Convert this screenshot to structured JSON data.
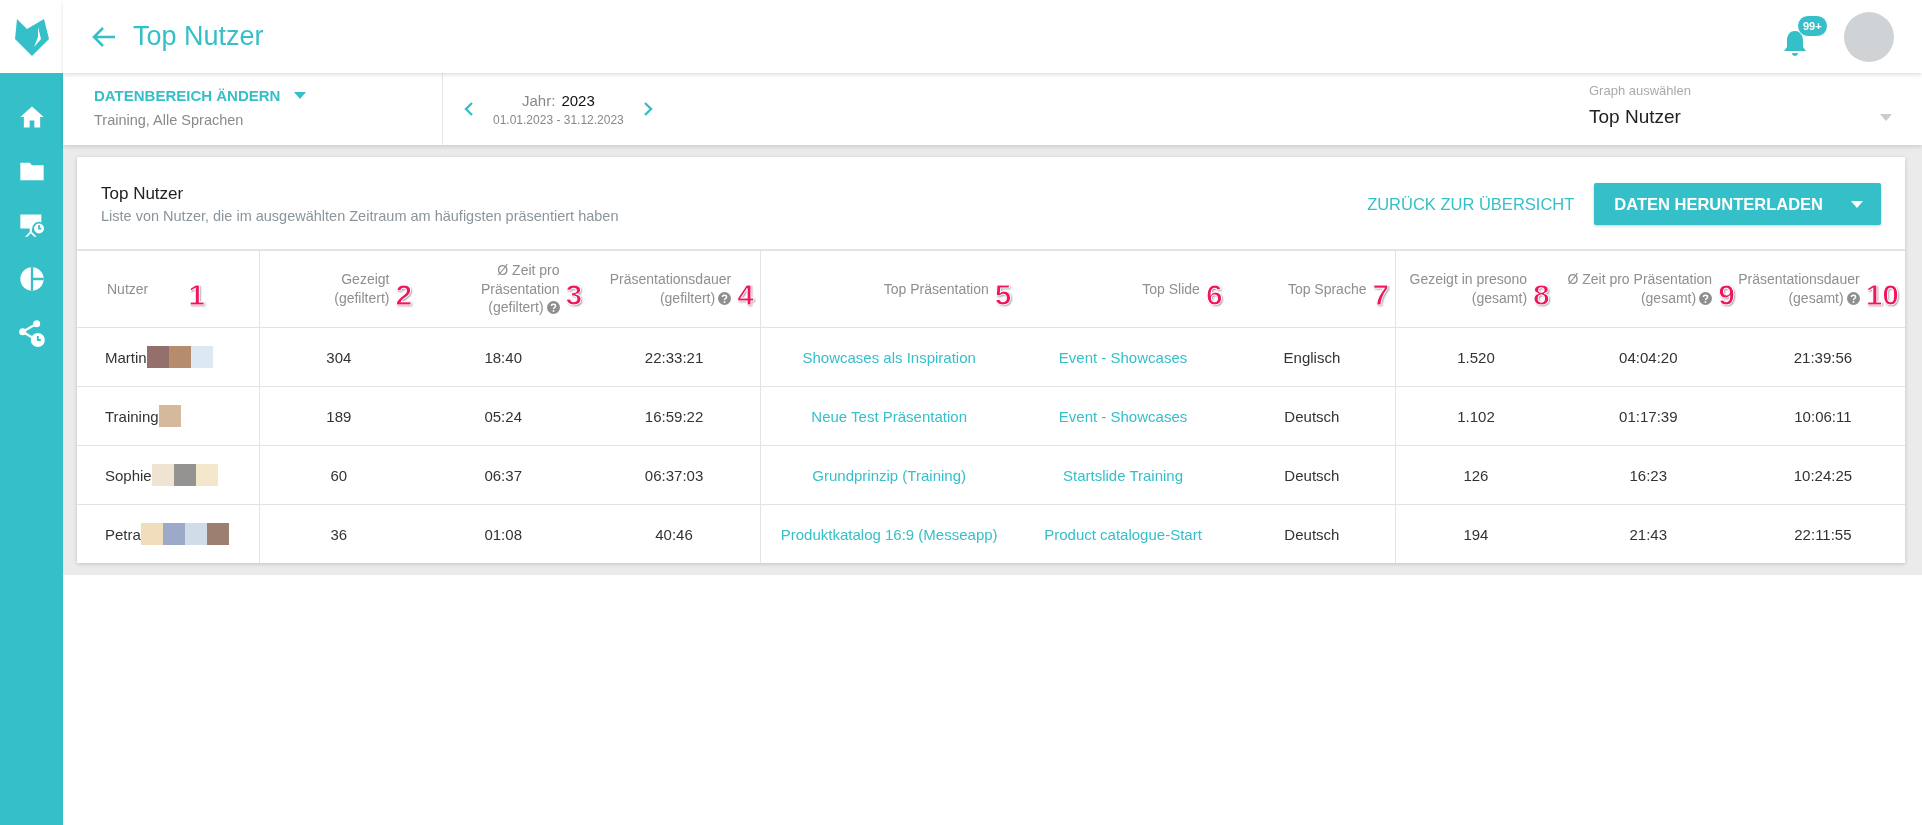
{
  "header": {
    "title": "Top Nutzer",
    "notification_badge": "99+"
  },
  "sidebar": {
    "items": [
      {
        "selected": false
      },
      {
        "selected": false
      },
      {
        "selected": false
      },
      {
        "selected": false
      },
      {
        "selected": false
      }
    ]
  },
  "filter_bar": {
    "range_button": "DATENBEREICH ÄNDERN",
    "range_summary": "Training, Alle Sprachen",
    "year_label": "Jahr:",
    "year": "2023",
    "date_range": "01.01.2023 - 31.12.2023",
    "graph_select": {
      "label": "Graph auswählen",
      "value": "Top Nutzer"
    }
  },
  "card": {
    "title": "Top Nutzer",
    "subtitle": "Liste von Nutzer, die im ausgewählten Zeitraum am häufigsten präsentiert haben",
    "back_link": "ZURÜCK ZUR ÜBERSICHT",
    "download_button": "DATEN HERUNTERLADEN"
  },
  "table": {
    "columns": [
      {
        "label": "Nutzer",
        "help": false,
        "marker": "1"
      },
      {
        "label": "Gezeigt",
        "sublabel": "(gefiltert)",
        "help": false,
        "marker": "2"
      },
      {
        "label": "Ø Zeit pro Präsentation",
        "sublabel": "(gefiltert)",
        "help": true,
        "marker": "3"
      },
      {
        "label": "Präsentationsdauer",
        "sublabel": "(gefiltert)",
        "help": true,
        "marker": "4"
      },
      {
        "label": "Top Präsentation",
        "help": false,
        "marker": "5"
      },
      {
        "label": "Top Slide",
        "help": false,
        "marker": "6"
      },
      {
        "label": "Top Sprache",
        "help": false,
        "marker": "7"
      },
      {
        "label": "Gezeigt in presono",
        "sublabel": "(gesamt)",
        "help": false,
        "marker": "8"
      },
      {
        "label": "Ø Zeit pro Präsentation",
        "sublabel": "(gesamt)",
        "help": true,
        "marker": "9"
      },
      {
        "label": "Präsentationsdauer",
        "sublabel": "(gesamt)",
        "help": true,
        "marker": "10"
      }
    ],
    "rows": [
      {
        "cells": [
          {
            "kind": "user",
            "text": "Martin",
            "redaction": [
              {
                "color": "#94706c"
              },
              {
                "color": "#b58c6e"
              },
              {
                "color": "#dde9f2"
              }
            ]
          },
          {
            "kind": "text",
            "text": "304"
          },
          {
            "kind": "text",
            "text": "18:40"
          },
          {
            "kind": "text",
            "text": "22:33:21"
          },
          {
            "kind": "link",
            "text": "Showcases als Inspiration"
          },
          {
            "kind": "link",
            "text": "Event - Showcases"
          },
          {
            "kind": "text",
            "text": "Englisch"
          },
          {
            "kind": "text",
            "text": "1.520"
          },
          {
            "kind": "text",
            "text": "04:04:20"
          },
          {
            "kind": "text",
            "text": "21:39:56"
          }
        ]
      },
      {
        "cells": [
          {
            "kind": "user",
            "text": "Training",
            "redaction": [
              {
                "color": "#d5b99c"
              }
            ]
          },
          {
            "kind": "text",
            "text": "189"
          },
          {
            "kind": "text",
            "text": "05:24"
          },
          {
            "kind": "text",
            "text": "16:59:22"
          },
          {
            "kind": "link",
            "text": "Neue Test Präsentation"
          },
          {
            "kind": "link",
            "text": "Event - Showcases"
          },
          {
            "kind": "text",
            "text": "Deutsch"
          },
          {
            "kind": "text",
            "text": "1.102"
          },
          {
            "kind": "text",
            "text": "01:17:39"
          },
          {
            "kind": "text",
            "text": "10:06:11"
          }
        ]
      },
      {
        "cells": [
          {
            "kind": "user",
            "text": "Sophie",
            "redaction": [
              {
                "color": "#efe3d2"
              },
              {
                "color": "#959392"
              },
              {
                "color": "#f2e7cb"
              }
            ]
          },
          {
            "kind": "text",
            "text": "60"
          },
          {
            "kind": "text",
            "text": "06:37"
          },
          {
            "kind": "text",
            "text": "06:37:03"
          },
          {
            "kind": "link",
            "text": "Grundprinzip (Training)"
          },
          {
            "kind": "link",
            "text": "Startslide Training"
          },
          {
            "kind": "text",
            "text": "Deutsch"
          },
          {
            "kind": "text",
            "text": "126"
          },
          {
            "kind": "text",
            "text": "16:23"
          },
          {
            "kind": "text",
            "text": "10:24:25"
          }
        ]
      },
      {
        "cells": [
          {
            "kind": "user",
            "text": "Petra",
            "redaction": [
              {
                "color": "#f0ddbc"
              },
              {
                "color": "#9ca9c9"
              },
              {
                "color": "#d0dce8"
              },
              {
                "color": "#9c7f70"
              }
            ]
          },
          {
            "kind": "text",
            "text": "36"
          },
          {
            "kind": "text",
            "text": "01:08"
          },
          {
            "kind": "text",
            "text": "40:46"
          },
          {
            "kind": "link",
            "text": "Produktkatalog 16:9 (Messeapp)"
          },
          {
            "kind": "link",
            "text": "Product catalogue-Start"
          },
          {
            "kind": "text",
            "text": "Deutsch"
          },
          {
            "kind": "text",
            "text": "194"
          },
          {
            "kind": "text",
            "text": "21:43"
          },
          {
            "kind": "text",
            "text": "22:11:55"
          }
        ]
      }
    ]
  }
}
